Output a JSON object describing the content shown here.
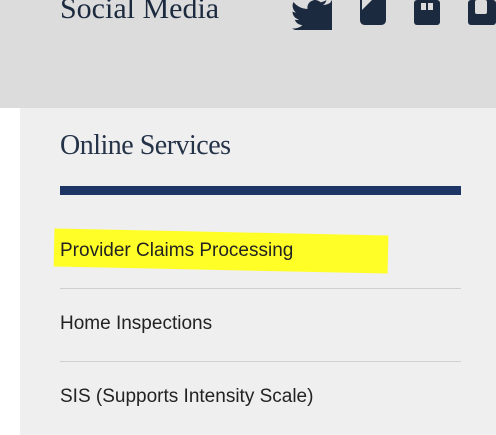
{
  "social": {
    "title": "Social Media",
    "icons": [
      "twitter-icon",
      "youtube-icon",
      "flickr-icon",
      "linkedin-icon"
    ]
  },
  "online_services": {
    "title": "Online Services",
    "links": [
      {
        "label": "Provider Claims Processing",
        "highlighted": true
      },
      {
        "label": "Home Inspections",
        "highlighted": false
      },
      {
        "label": "SIS (Supports Intensity Scale)",
        "highlighted": false
      }
    ]
  },
  "colors": {
    "header_background": "#dcdcdc",
    "panel_background": "#efefef",
    "rule": "#1c3565",
    "title_text": "#253349",
    "highlight": "#ffff27",
    "divider": "#cfcfcf"
  }
}
